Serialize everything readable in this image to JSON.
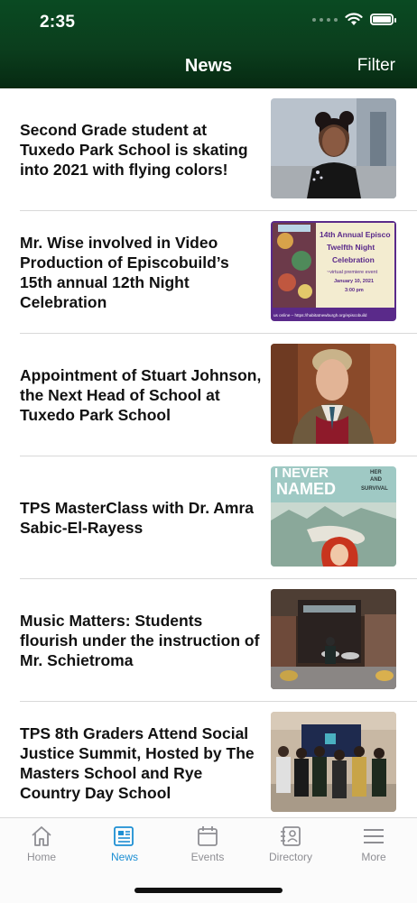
{
  "status": {
    "time": "2:35"
  },
  "nav": {
    "title": "News",
    "filter_label": "Filter"
  },
  "news_items": [
    {
      "title": "Second Grade student at Tuxedo Park School is skating into 2021 with flying colors!",
      "image": "skater-girl-photo"
    },
    {
      "title": "Mr. Wise involved in Video Production of Episcobuild’s 15th annual 12th Night Celebration",
      "image": "twelfth-night-flyer",
      "flyer": {
        "line1": "14th Annual Episco",
        "line2": "Twelfth Night",
        "line3": "Celebration",
        "line4": "~virtual premiere event",
        "line5": "January 10, 2021",
        "line6": "3:00 pm",
        "footer": "us online – https://habitatnewburgh.org/episcobuild"
      }
    },
    {
      "title": "Appointment of Stuart Johnson, the Next Head of School at Tuxedo Park School",
      "image": "portrait-photo"
    },
    {
      "title": "TPS MasterClass with Dr. Amra Sabic-El-Rayess",
      "image": "book-cover",
      "cover": {
        "line1": "I NEVER",
        "line2": "NAMED",
        "side1": "HER",
        "side2": "AND",
        "side3": "SURVIVAL"
      }
    },
    {
      "title": "Music Matters: Students flourish under the instruction of Mr. Schietroma",
      "image": "steel-drums-photo"
    },
    {
      "title": "TPS 8th Graders Attend Social Justice Summit, Hosted by The Masters School and Rye Country Day School",
      "image": "group-photo"
    }
  ],
  "tabbar": {
    "items": [
      {
        "label": "Home",
        "icon": "home-icon"
      },
      {
        "label": "News",
        "icon": "news-icon",
        "active": true
      },
      {
        "label": "Events",
        "icon": "calendar-icon"
      },
      {
        "label": "Directory",
        "icon": "directory-icon"
      },
      {
        "label": "More",
        "icon": "menu-icon"
      }
    ]
  },
  "colors": {
    "header": "#0b3e1d",
    "active_tab": "#1d8fd3",
    "inactive_tab": "#8e8e93"
  }
}
